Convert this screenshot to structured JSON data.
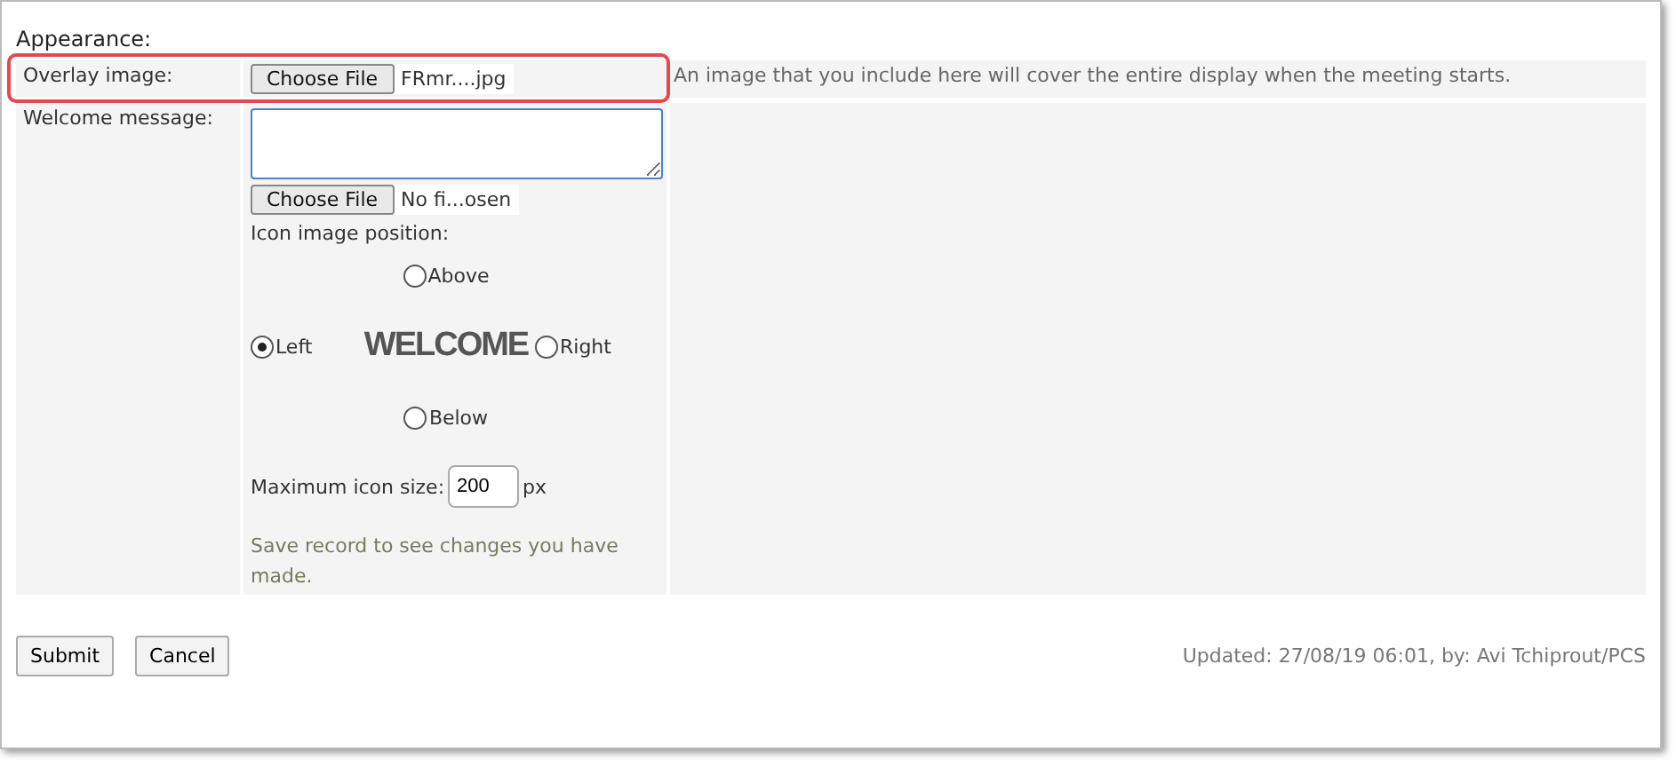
{
  "section_title": "Appearance:",
  "overlay": {
    "label": "Overlay image:",
    "button": "Choose File",
    "file_name": "FRmr....jpg",
    "help": "An image that you include here will cover the entire display when the meeting starts.",
    "highlighted": true
  },
  "welcome": {
    "label": "Welcome message:",
    "button": "Choose File",
    "file_name": "No fi...osen",
    "position_label": "Icon image position:",
    "positions": [
      {
        "label": "Above",
        "selected": false
      },
      {
        "label": "Left",
        "selected": true
      },
      {
        "label": "Right",
        "selected": false
      },
      {
        "label": "Below",
        "selected": false
      }
    ],
    "preview_text": "WELCOME",
    "size_label": "Maximum icon size:",
    "size_value": "200",
    "size_unit": "px",
    "note": "Save record to see changes you have made."
  },
  "buttons": [
    "Submit",
    "Cancel"
  ],
  "updated": "Updated: 27/08/19 06:01, by: Avi Tchiprout/PCS"
}
